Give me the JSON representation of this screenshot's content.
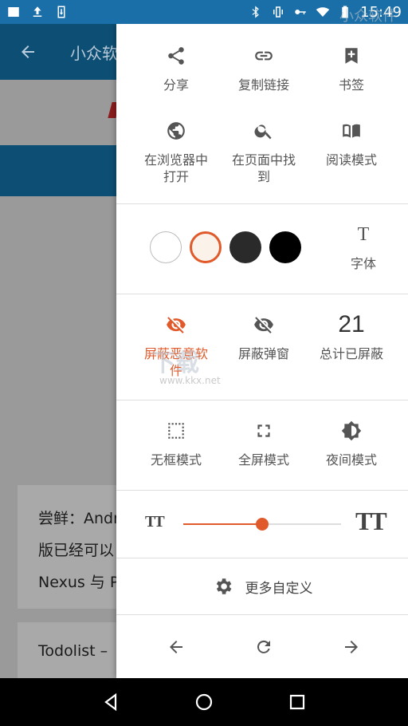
{
  "status_bar": {
    "time": "15:49",
    "left_icons": [
      "image-icon",
      "upload-icon",
      "download-icon"
    ],
    "right_icons": [
      "bluetooth-icon",
      "vibrate-icon",
      "key-icon",
      "wifi-icon",
      "battery-icon"
    ]
  },
  "background_app": {
    "title": "小众软",
    "card1_lines": [
      "尝鲜：Andr",
      "版已经可以",
      "Nexus 与 P"
    ],
    "card2_text": "Todolist –"
  },
  "menu": {
    "share_row": [
      {
        "icon": "share-icon",
        "label": "分享"
      },
      {
        "icon": "link-icon",
        "label": "复制链接"
      },
      {
        "icon": "bookmark-icon",
        "label": "书签"
      }
    ],
    "open_row": [
      {
        "icon": "globe-icon",
        "label": "在浏览器中打开"
      },
      {
        "icon": "search-icon",
        "label": "在页面中找到"
      },
      {
        "icon": "book-icon",
        "label": "阅读模式"
      }
    ],
    "font_label": "字体",
    "font_glyph": "T",
    "block_row": [
      {
        "icon": "eye-off-icon",
        "label": "屏蔽恶意软件",
        "active": true
      },
      {
        "icon": "eye-off-icon",
        "label": "屏蔽弹窗"
      },
      {
        "count": "21",
        "label": "总计已屏蔽"
      }
    ],
    "mode_row": [
      {
        "icon": "frameless-icon",
        "label": "无框模式"
      },
      {
        "icon": "fullscreen-icon",
        "label": "全屏模式"
      },
      {
        "icon": "night-mode-icon",
        "label": "夜间模式"
      }
    ],
    "text_size": {
      "small": "TT",
      "large": "TT",
      "value": 0.5
    },
    "more_label": "更多自定义"
  },
  "watermark": {
    "top": "小众软件",
    "mid": "下载",
    "url": "www.kkx.net"
  },
  "colors": {
    "accent": "#e05a2b",
    "toolbar": "#0d4f74",
    "status_bar": "#1a6fa8"
  }
}
